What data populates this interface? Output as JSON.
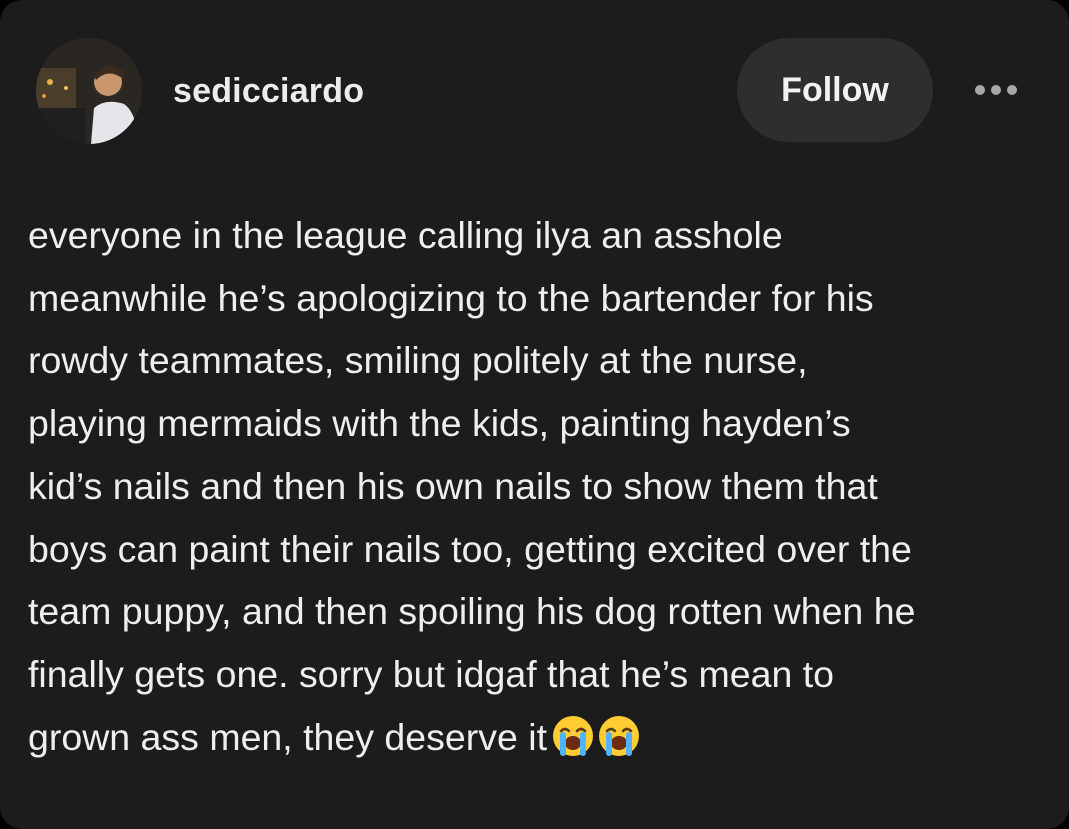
{
  "post": {
    "author": {
      "username": "sedicciardo",
      "avatar_icon": "profile-photo"
    },
    "follow_label": "Follow",
    "more_icon": "ellipsis-icon",
    "body_lines": [
      "everyone in the league calling ilya an asshole",
      "meanwhile he’s apologizing to the bartender for his",
      "rowdy teammates, smiling politely at the nurse,",
      "playing mermaids with the kids, painting hayden’s",
      "kid’s nails and then his own nails to show them that",
      "boys can paint their nails too, getting excited over the",
      "team puppy, and then spoiling his dog rotten when he",
      "finally gets one. sorry but idgaf that he’s mean to",
      "grown ass men, they deserve it"
    ],
    "trailing_emojis": [
      "loudly-crying-face",
      "loudly-crying-face"
    ]
  },
  "colors": {
    "background": "#1c1c1c",
    "text": "#eeeeee",
    "button_bg": "#2e2e2e",
    "emoji_face": "#ffcc33",
    "emoji_tears": "#4fb3ff"
  }
}
